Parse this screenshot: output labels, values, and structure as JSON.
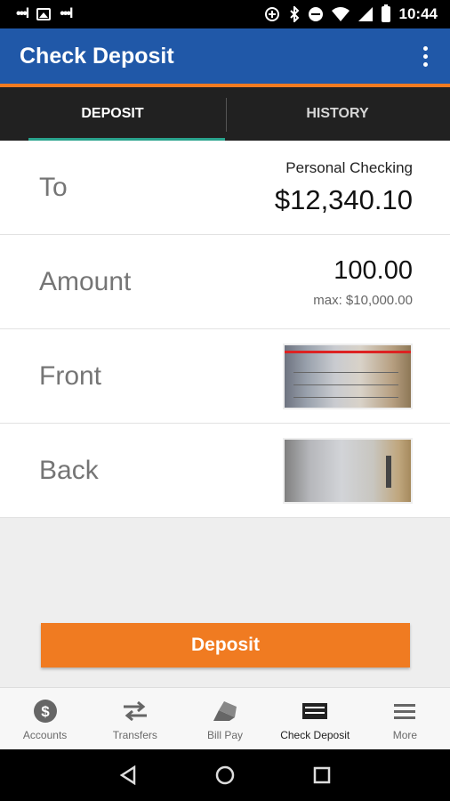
{
  "status_bar": {
    "time": "10:44"
  },
  "app_bar": {
    "title": "Check Deposit"
  },
  "tabs": [
    {
      "label": "DEPOSIT",
      "active": true
    },
    {
      "label": "HISTORY",
      "active": false
    }
  ],
  "rows": {
    "to": {
      "label": "To",
      "account": "Personal Checking",
      "balance": "$12,340.10"
    },
    "amount": {
      "label": "Amount",
      "value": "100.00",
      "max": "max: $10,000.00"
    },
    "front": {
      "label": "Front"
    },
    "back": {
      "label": "Back"
    }
  },
  "deposit_button": {
    "label": "Deposit"
  },
  "bottom_nav": [
    {
      "label": "Accounts",
      "icon": "dollar-icon"
    },
    {
      "label": "Transfers",
      "icon": "transfer-icon"
    },
    {
      "label": "Bill Pay",
      "icon": "bill-pay-icon"
    },
    {
      "label": "Check Deposit",
      "icon": "check-deposit-icon",
      "active": true
    },
    {
      "label": "More",
      "icon": "menu-icon"
    }
  ],
  "colors": {
    "app_bar": "#2058a8",
    "accent": "#f07b21",
    "tab_indicator": "#2aa38d"
  }
}
